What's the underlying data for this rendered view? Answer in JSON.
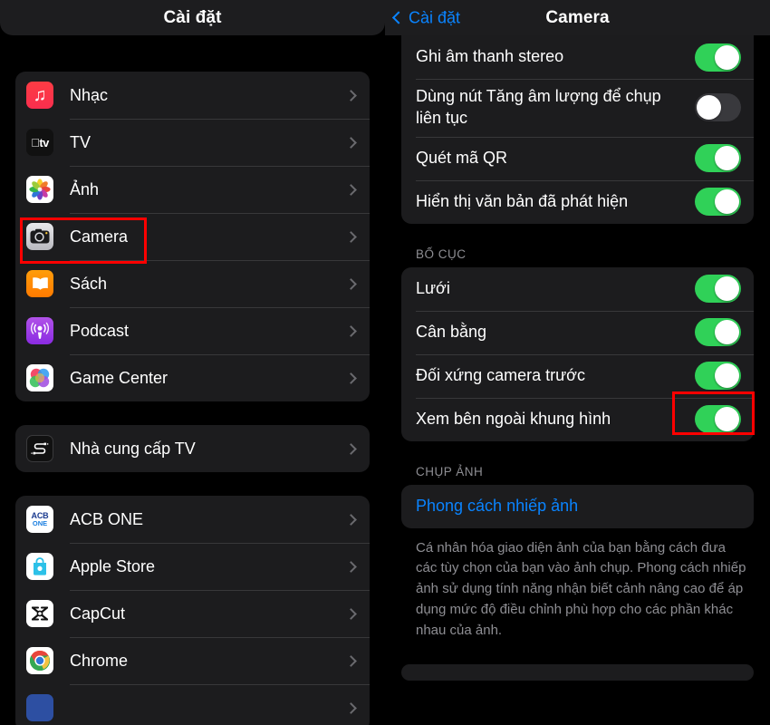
{
  "left_panel": {
    "nav": {
      "title": "Cài đặt"
    },
    "groups": [
      {
        "id": "apps-apple",
        "rows": [
          {
            "label": "Nhạc",
            "icon": "music-icon"
          },
          {
            "label": "TV",
            "icon": "appletv-icon"
          },
          {
            "label": "Ảnh",
            "icon": "photos-icon"
          },
          {
            "label": "Camera",
            "icon": "camera-icon",
            "highlighted": true
          },
          {
            "label": "Sách",
            "icon": "books-icon"
          },
          {
            "label": "Podcast",
            "icon": "podcast-icon"
          },
          {
            "label": "Game Center",
            "icon": "gamecenter-icon"
          }
        ]
      },
      {
        "id": "tv-provider",
        "rows": [
          {
            "label": "Nhà cung cấp TV",
            "icon": "tvprovider-icon"
          }
        ]
      },
      {
        "id": "third-party-apps",
        "rows": [
          {
            "label": "ACB ONE",
            "icon": "acbone-icon"
          },
          {
            "label": "Apple Store",
            "icon": "applestore-icon"
          },
          {
            "label": "CapCut",
            "icon": "capcut-icon"
          },
          {
            "label": "Chrome",
            "icon": "chrome-icon"
          }
        ]
      }
    ]
  },
  "right_panel": {
    "nav": {
      "back_label": "Cài đặt",
      "title": "Camera"
    },
    "group_top": {
      "rows": [
        {
          "label": "Ghi âm thanh stereo",
          "toggle": "on"
        },
        {
          "label": "Dùng nút Tăng âm lượng để chụp liên tục",
          "toggle": "off"
        },
        {
          "label": "Quét mã QR",
          "toggle": "on"
        },
        {
          "label": "Hiển thị văn bản đã phát hiện",
          "toggle": "on"
        }
      ]
    },
    "section_layout": {
      "header": "BỐ CỤC",
      "rows": [
        {
          "label": "Lưới",
          "toggle": "on"
        },
        {
          "label": "Cân bằng",
          "toggle": "on"
        },
        {
          "label": "Đối xứng camera trước",
          "toggle": "on",
          "highlighted": true
        },
        {
          "label": "Xem bên ngoài khung hình",
          "toggle": "on"
        }
      ]
    },
    "section_photo": {
      "header": "CHỤP ẢNH",
      "rows": [
        {
          "label": "Phong cách nhiếp ảnh",
          "style": "link"
        }
      ],
      "footer": "Cá nhân hóa giao diện ảnh của bạn bằng cách đưa các tùy chọn của bạn vào ảnh chụp. Phong cách nhiếp ảnh sử dụng tính năng nhận biết cảnh nâng cao để áp dụng mức độ điều chỉnh phù hợp cho các phần khác nhau của ảnh."
    }
  },
  "colors": {
    "accent_blue": "#0a84ff",
    "toggle_on": "#30d158",
    "toggle_off": "#39393d",
    "card_bg": "#1c1c1e",
    "highlight_red": "#ff0000",
    "secondary_text": "#8e8e93"
  }
}
